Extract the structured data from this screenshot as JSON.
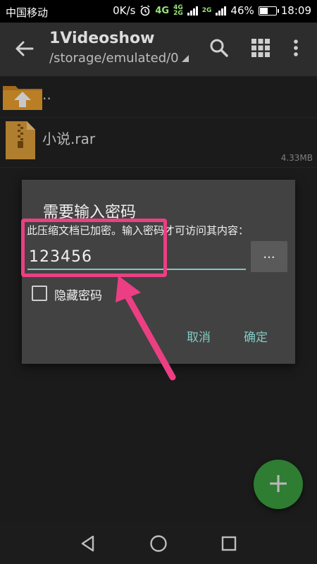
{
  "status": {
    "carrier": "中国移动",
    "speed": "0K/s",
    "net1": "4G",
    "net2a": "4G",
    "net2b": "2G",
    "net3": "2G",
    "battery_percent_label": "46%",
    "battery_level": 0.46,
    "time": "18:09"
  },
  "toolbar": {
    "title": "1Videoshow",
    "path": "/storage/emulated/0",
    "icons": [
      "back-arrow-icon",
      "search-icon",
      "grid-view-icon",
      "more-vert-icon"
    ]
  },
  "files": {
    "updir_label": "..",
    "item": {
      "name": "小说.rar",
      "size": "4.33MB"
    }
  },
  "dialog": {
    "title": "需要输入密码",
    "message": "此压缩文档已加密。输入密码才可访问其内容：",
    "password_value": "123456",
    "browse_label": "...",
    "hide_password_label": "隐藏密码",
    "hide_password_checked": false,
    "cancel_label": "取消",
    "ok_label": "确定"
  },
  "fab": {
    "label": "+"
  },
  "colors": {
    "accent": "#80cbc4",
    "highlight": "#ec3f83",
    "fab": "#2e7d32",
    "dialog_bg": "#424242",
    "page_bg": "#212121"
  }
}
